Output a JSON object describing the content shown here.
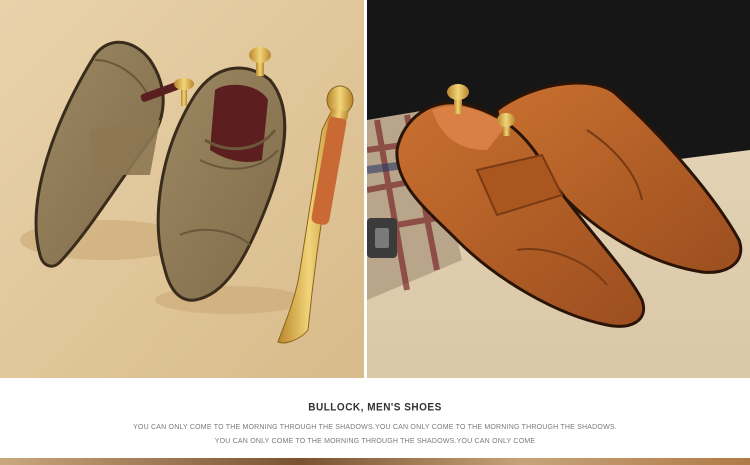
{
  "caption": {
    "title": "BULLOCK, MEN'S SHOES",
    "line1": "YOU CAN ONLY COME TO THE MORNING THROUGH THE SHADOWS.YOU CAN ONLY COME TO THE MORNING THROUGH THE SHADOWS.",
    "line2": "YOU CAN ONLY COME TO THE MORNING THROUGH THE SHADOWS.YOU CAN ONLY COME"
  },
  "colors": {
    "left_background": "#e6cfa7",
    "right_background": "#161616",
    "khaki_suede": "#8f7a55",
    "brown_suede": "#b5612a",
    "gold": "#d9b24a"
  }
}
